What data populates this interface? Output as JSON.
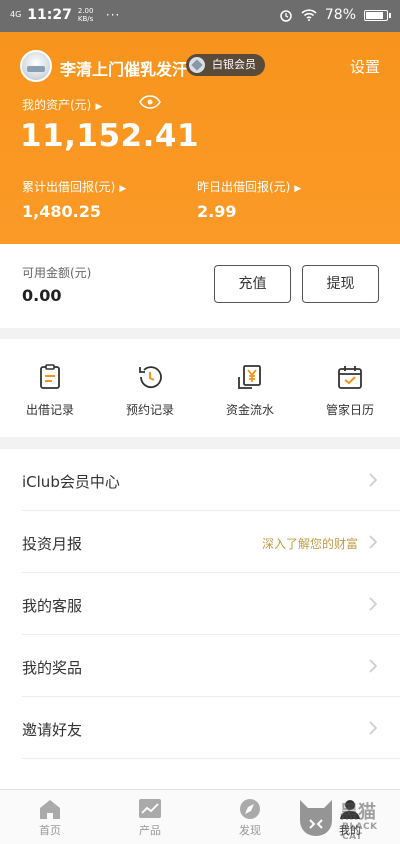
{
  "status_bar": {
    "network": "4G",
    "time": "11:27",
    "speed": "2.00 KB/s",
    "dots": "···",
    "battery": "78%"
  },
  "header": {
    "username": "李清上门催乳发汗",
    "member_badge": "白银会员",
    "settings": "设置",
    "asset_label": "我的资产(元)",
    "asset_value": "11,152.41",
    "cumulative_label": "累计出借回报(元)",
    "cumulative_value": "1,480.25",
    "yesterday_label": "昨日出借回报(元)",
    "yesterday_value": "2.99"
  },
  "balance": {
    "label": "可用金额(元)",
    "value": "0.00",
    "recharge_label": "充值",
    "withdraw_label": "提现"
  },
  "actions": [
    {
      "label": "出借记录",
      "icon": "clipboard-icon"
    },
    {
      "label": "预约记录",
      "icon": "clock-history-icon"
    },
    {
      "label": "资金流水",
      "icon": "yen-icon"
    },
    {
      "label": "管家日历",
      "icon": "calendar-check-icon"
    }
  ],
  "menu": [
    {
      "label": "iClub会员中心",
      "hint": ""
    },
    {
      "label": "投资月报",
      "hint": "深入了解您的财富"
    },
    {
      "label": "我的客服",
      "hint": ""
    },
    {
      "label": "我的奖品",
      "hint": ""
    },
    {
      "label": "邀请好友",
      "hint": ""
    }
  ],
  "bottom_nav": [
    {
      "label": "首页",
      "icon": "home-icon"
    },
    {
      "label": "产品",
      "icon": "chart-icon"
    },
    {
      "label": "发现",
      "icon": "compass-icon"
    },
    {
      "label": "我的",
      "icon": "user-icon"
    }
  ],
  "watermark": {
    "text": "黑猫",
    "sub": "BLACK CAT"
  },
  "colors": {
    "header_orange": "#f7941d",
    "hint_gold": "#c49a45",
    "status_gray": "#6d6d6d"
  }
}
